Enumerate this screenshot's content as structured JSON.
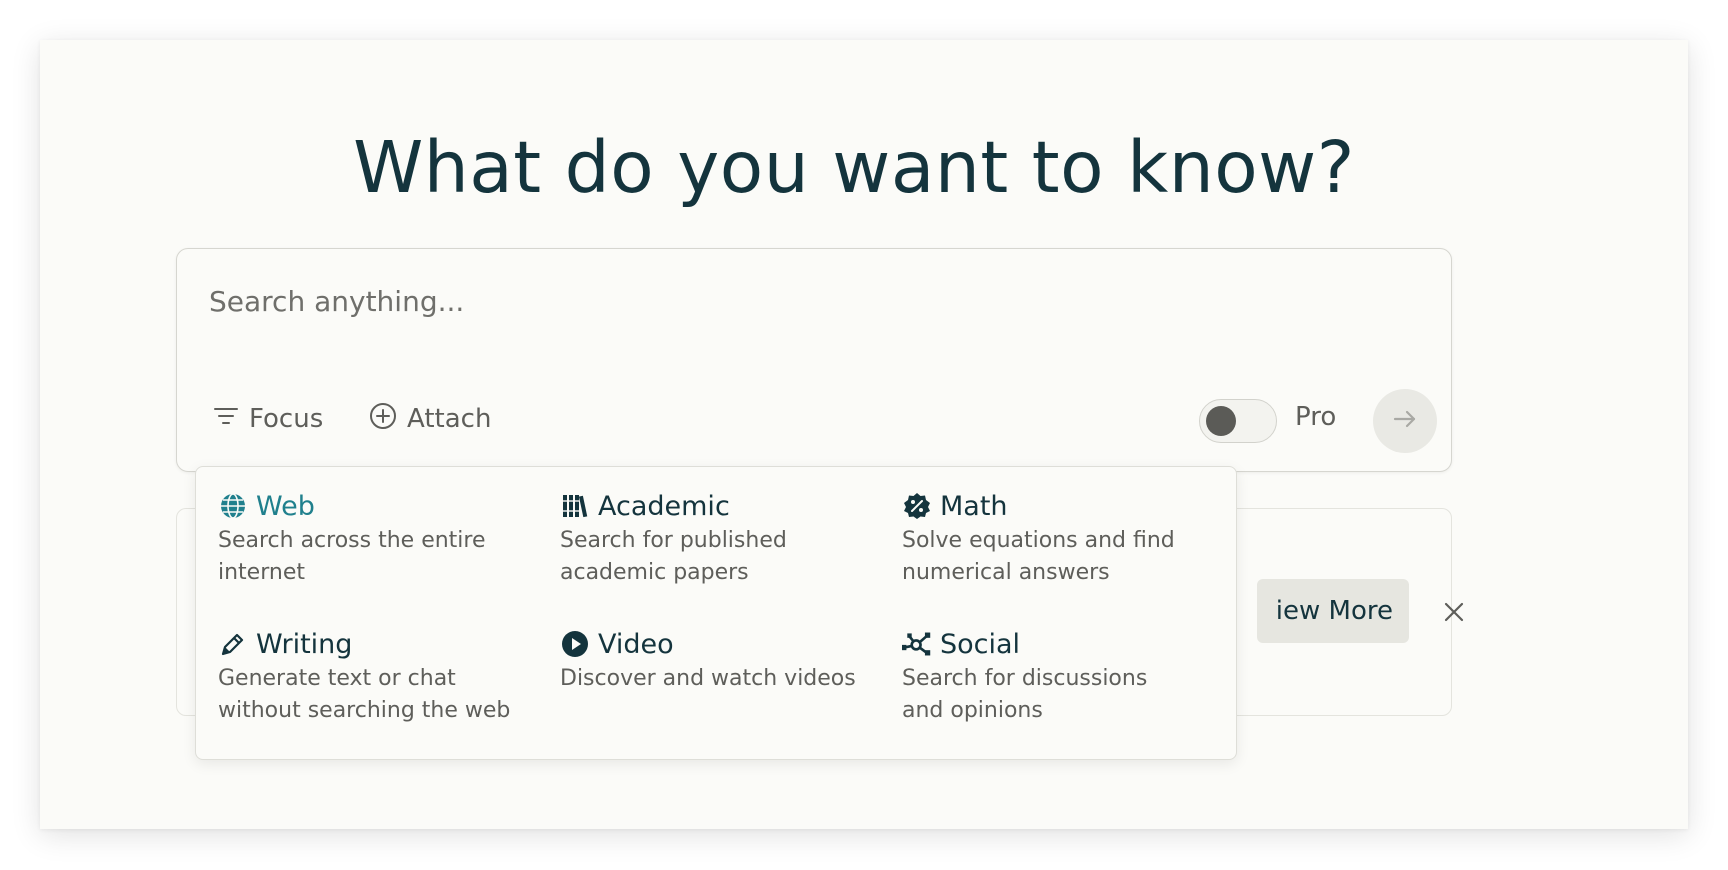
{
  "headline": "What do you want to know?",
  "search": {
    "placeholder": "Search anything...",
    "focus_label": "Focus",
    "attach_label": "Attach",
    "pro_label": "Pro",
    "pro_enabled": false
  },
  "background_card": {
    "view_more_label": "iew More"
  },
  "focus_menu": {
    "options": [
      {
        "title": "Web",
        "description": "Search across the entire\ninternet",
        "icon": "globe-icon",
        "active": true
      },
      {
        "title": "Academic",
        "description": "Search for published\nacademic papers",
        "icon": "books-icon",
        "active": false
      },
      {
        "title": "Math",
        "description": "Solve equations and find\nnumerical answers",
        "icon": "percent-badge-icon",
        "active": false
      },
      {
        "title": "Writing",
        "description": "Generate text or chat\nwithout searching the web",
        "icon": "pencil-icon",
        "active": false
      },
      {
        "title": "Video",
        "description": "Discover and watch videos",
        "icon": "play-circle-icon",
        "active": false
      },
      {
        "title": "Social",
        "description": "Search for discussions\nand opinions",
        "icon": "social-network-icon",
        "active": false
      }
    ]
  },
  "colors": {
    "background": "#fbfbf8",
    "text_primary": "#14343d",
    "text_secondary": "#5e5e5a",
    "accent": "#20808d"
  }
}
